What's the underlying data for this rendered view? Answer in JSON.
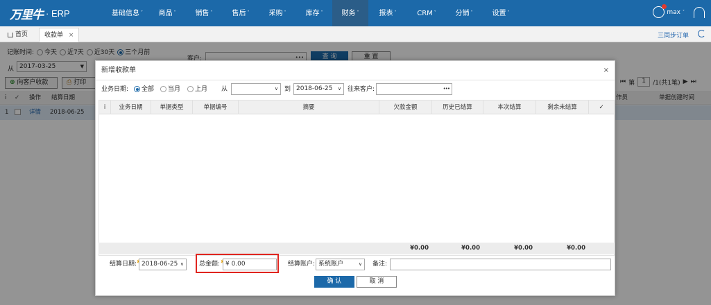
{
  "app": {
    "brand": "万里牛",
    "product": "· ERP"
  },
  "nav": {
    "items": [
      {
        "label": "基础信息",
        "caret": "˅"
      },
      {
        "label": "商品",
        "caret": "˅"
      },
      {
        "label": "销售",
        "caret": "˅"
      },
      {
        "label": "售后",
        "caret": "˅"
      },
      {
        "label": "采购",
        "caret": "˅"
      },
      {
        "label": "库存",
        "caret": "˅"
      },
      {
        "label": "财务",
        "caret": "˅"
      },
      {
        "label": "报表",
        "caret": "˅"
      },
      {
        "label": "CRM",
        "caret": "˅"
      },
      {
        "label": "分销",
        "caret": "˅"
      },
      {
        "label": "设置",
        "caret": "˅"
      }
    ],
    "active_index": 6,
    "user": "max",
    "user_caret": "˅"
  },
  "tabs": {
    "home": "首页",
    "current": "收款单",
    "close": "×"
  },
  "sync_button": "三同步订单",
  "bgpage": {
    "time_label": "记账时间:",
    "time_options": [
      "今天",
      "近7天",
      "近30天",
      "三个月前"
    ],
    "customer_label": "客户:",
    "from_label": "从",
    "from_date": "2017-03-25",
    "query_button": "查 询",
    "reset_button": "重 置",
    "collect_button": "向客户收款",
    "print_button": "打印",
    "pager": {
      "page": "1",
      "total": "/1(共1笔)",
      "prefix": "第"
    },
    "columns": [
      "i",
      "✓",
      "操作",
      "结算日期",
      "作员",
      "单据创建时间"
    ],
    "row": {
      "index": "1",
      "action": "详情",
      "date": "2018-06-25"
    }
  },
  "dialog": {
    "title": "新增收款单",
    "close": "×",
    "biz_date_label": "业务日期:",
    "date_options": [
      "全部",
      "当月",
      "上月"
    ],
    "from_label": "从",
    "from_value": "",
    "to_label": "到",
    "to_value": "2018-06-25",
    "customer_label": "往来客户:",
    "customer_ellipsis": "•••",
    "columns": [
      "i",
      "业务日期",
      "单据类型",
      "单据编号",
      "摘要",
      "欠款金额",
      "历史已结算",
      "本次结算",
      "剩余未结算",
      "✓"
    ],
    "totals": [
      "¥0.00",
      "¥0.00",
      "¥0.00",
      "¥0.00"
    ],
    "settle_date_label": "结算日期:",
    "settle_date_value": "2018-06-25",
    "total_amount_label": "总金额:",
    "total_amount_value": "¥ 0.00",
    "account_label": "结算账户:",
    "account_value": "系统账户",
    "remark_label": "备注:",
    "remark_value": "",
    "confirm_button": "确 认",
    "cancel_button": "取 消"
  }
}
